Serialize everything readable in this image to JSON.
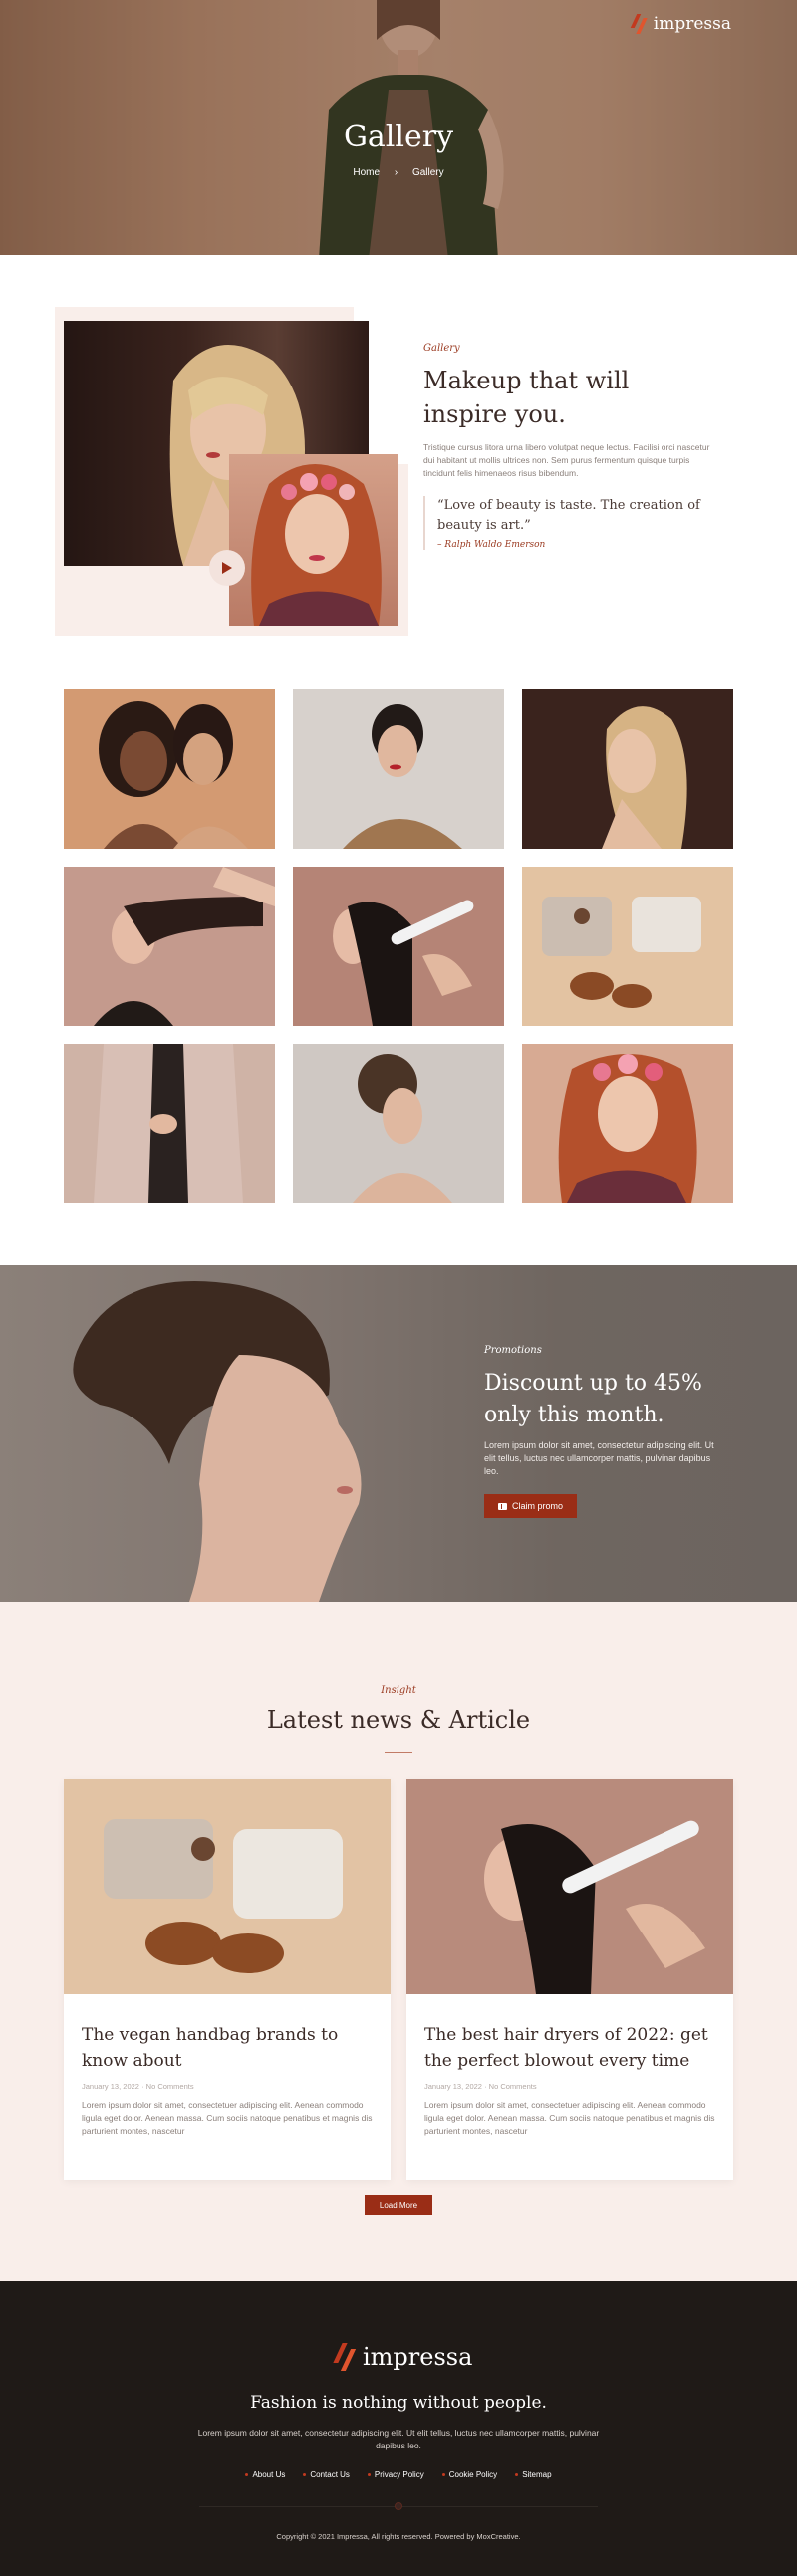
{
  "brand": {
    "name": "impressa",
    "accent": "#9a2d16",
    "logo_color": "#c23a1f"
  },
  "hero": {
    "title": "Gallery",
    "breadcrumb": {
      "home": "Home",
      "separator": "›",
      "current": "Gallery"
    }
  },
  "about": {
    "eyebrow": "Gallery",
    "heading": "Makeup that will inspire you.",
    "body": "Tristique cursus litora urna libero volutpat neque lectus. Facilisi orci nascetur dui habitant ut mollis ultrices non. Sem purus fermentum quisque turpis tincidunt felis himenaeos risus bibendum.",
    "quote": "“Love of beauty is taste. The creation of beauty is art.”",
    "quote_author": "– Ralph Waldo Emerson",
    "play_icon": "play-icon"
  },
  "gallery": {
    "items": [
      {
        "name": "two-women-portrait"
      },
      {
        "name": "woman-red-lips"
      },
      {
        "name": "blonde-ponytail"
      },
      {
        "name": "hair-profile"
      },
      {
        "name": "hair-straightener"
      },
      {
        "name": "knitwear-flatlay"
      },
      {
        "name": "blazer-closeup"
      },
      {
        "name": "curly-updo"
      },
      {
        "name": "flower-crown"
      }
    ]
  },
  "promo": {
    "eyebrow": "Promotions",
    "heading": "Discount up to 45% only this month.",
    "body": "Lorem ipsum dolor sit amet, consectetur adipiscing elit. Ut elit tellus, luctus nec ullamcorper mattis, pulvinar dapibus leo.",
    "button": "Claim promo",
    "button_icon": "ticket-icon"
  },
  "news": {
    "eyebrow": "Insight",
    "heading": "Latest news & Article",
    "articles": [
      {
        "title": "The vegan handbag brands to know about",
        "date": "January 13, 2022",
        "comments": "No Comments",
        "excerpt": "Lorem ipsum dolor sit amet, consectetuer adipiscing elit. Aenean commodo ligula eget dolor. Aenean massa. Cum sociis natoque penatibus et magnis dis parturient montes, nascetur"
      },
      {
        "title": "The best hair dryers of 2022: get the perfect blowout every time",
        "date": "January 13, 2022",
        "comments": "No Comments",
        "excerpt": "Lorem ipsum dolor sit amet, consectetuer adipiscing elit. Aenean commodo ligula eget dolor. Aenean massa. Cum sociis natoque penatibus et magnis dis parturient montes, nascetur"
      }
    ],
    "meta_sep": "·",
    "load_more": "Load More"
  },
  "footer": {
    "tagline": "Fashion is nothing without people.",
    "description": "Lorem ipsum dolor sit amet, consectetur adipiscing elit. Ut elit tellus, luctus nec ullamcorper mattis, pulvinar dapibus leo.",
    "links": [
      "About Us",
      "Contact Us",
      "Privacy Policy",
      "Cookie Policy",
      "Sitemap"
    ],
    "copyright": "Copyright © 2021 Impressa, All rights reserved. Powered by MoxCreative."
  }
}
